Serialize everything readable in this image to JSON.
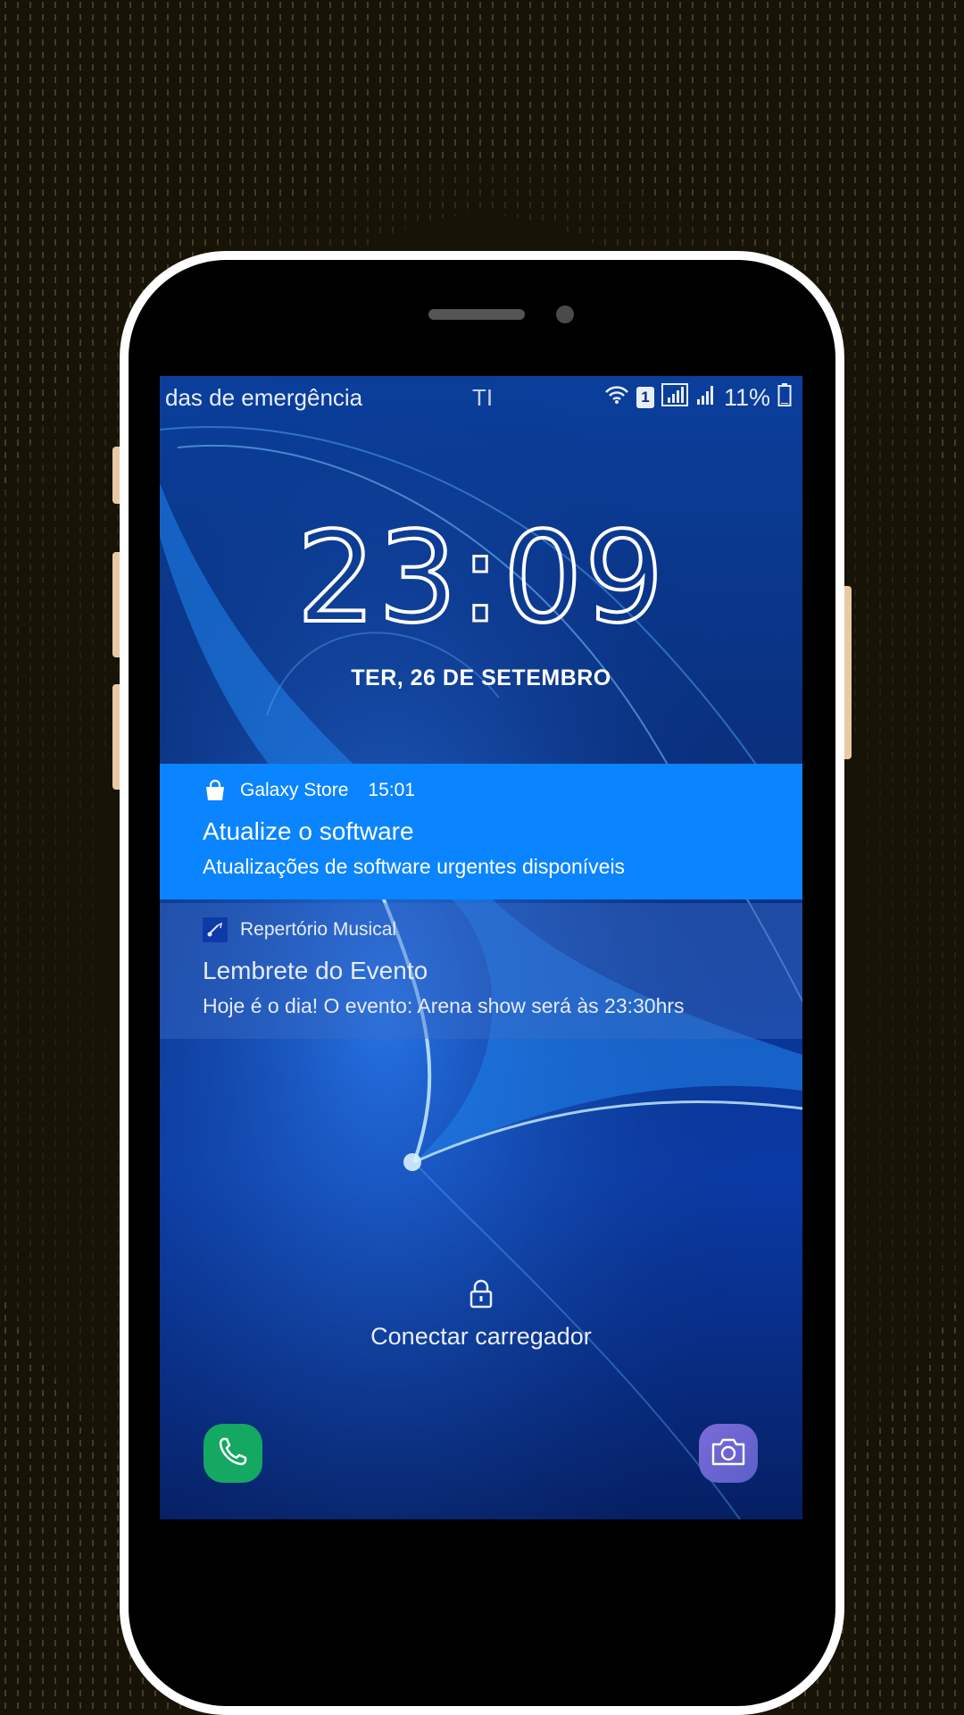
{
  "status_bar": {
    "carrier_text": "das de emergência",
    "carrier_text_2": "TI",
    "sim_slot": "1",
    "battery_percent": "11%"
  },
  "lock_screen": {
    "clock": {
      "hours": "23",
      "minutes": "09"
    },
    "date": "TER, 26 DE SETEMBRO",
    "charger_message": "Conectar carregador"
  },
  "notifications": [
    {
      "app": "Galaxy Store",
      "time": "15:01",
      "title": "Atualize o software",
      "body": "Atualizações de software urgentes disponíveis",
      "icon": "shopping-bag-icon"
    },
    {
      "app": "Repertório Musical",
      "title": "Lembrete do Evento",
      "body": "Hoje é o dia! O evento:  Arena show  será às 23:30hrs",
      "icon": "music-app-icon"
    }
  ],
  "dock": {
    "left": "phone-icon",
    "right": "camera-icon"
  },
  "colors": {
    "notification_highlight": "#0a84ff",
    "phone_button": "#14a862",
    "camera_button": "#6a66d2"
  }
}
